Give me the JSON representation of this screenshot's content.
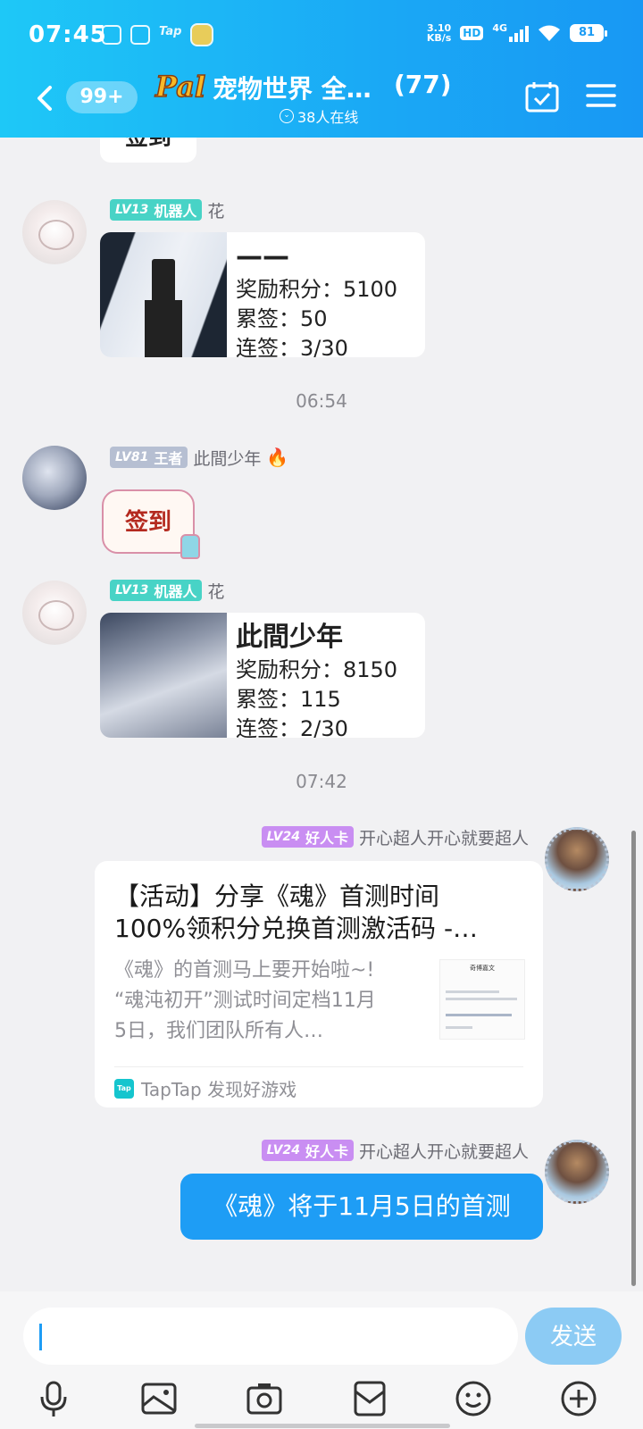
{
  "status_bar": {
    "time": "07:45",
    "notif_icons": [
      "doc-icon",
      "face-icon",
      "tap-icon",
      "game-icon"
    ],
    "tap_text": "Tap",
    "speed_top": "3.10",
    "speed_bottom": "KB/s",
    "hd": "HD",
    "network": "4G",
    "battery": "81"
  },
  "header": {
    "unread": "99+",
    "logo_text": "Pal",
    "title": "宠物世界 全…",
    "member_count": "(77)",
    "online": "38人在线"
  },
  "colors": {
    "header_start": "#1ec8f7",
    "header_end": "#1898f4",
    "accent_blue": "#1e9df5",
    "send_disabled": "#8ccbf4",
    "badge_bot": "#48d3c6",
    "badge_king": "#b6bfd2",
    "badge_good": "#c98ef2"
  },
  "messages": {
    "cut_bubble": "签到",
    "m1": {
      "level": "LV13",
      "role": "机器人",
      "sender": "花",
      "card_title": "——",
      "points": "奖励积分：5100",
      "total": "累签：50",
      "streak": "连签：3/30"
    },
    "sep1": "06:54",
    "m2": {
      "level": "LV81",
      "role": "王者",
      "sender": "此間少年",
      "sticker_text": "签到"
    },
    "m3": {
      "level": "LV13",
      "role": "机器人",
      "sender": "花",
      "card_title": "此間少年",
      "points": "奖励积分：8150",
      "total": "累签：115",
      "streak": "连签：2/30"
    },
    "sep2": "07:42",
    "m4": {
      "level": "LV24",
      "role": "好人卡",
      "sender": "开心超人开心就要超人",
      "link_title_1": "【活动】分享《魂》首测时间",
      "link_title_2": "100%领积分兑换首测激活码 -…",
      "link_desc_1": "《魂》的首测马上要开始啦~!",
      "link_desc_2": "“魂沌初开”测试时间定档11月",
      "link_desc_3": "5日，我们团队所有人…",
      "thumb_title": "奇博嘉文",
      "source_logo": "Tap",
      "source": "TapTap 发现好游戏"
    },
    "m5": {
      "level": "LV24",
      "role": "好人卡",
      "sender": "开心超人开心就要超人",
      "text": "《魂》将于11月5日的首测"
    }
  },
  "input": {
    "value": "",
    "send_label": "发送"
  },
  "toolbar": [
    "mic-icon",
    "image-icon",
    "camera-icon",
    "file-icon",
    "emoji-icon",
    "plus-icon"
  ]
}
